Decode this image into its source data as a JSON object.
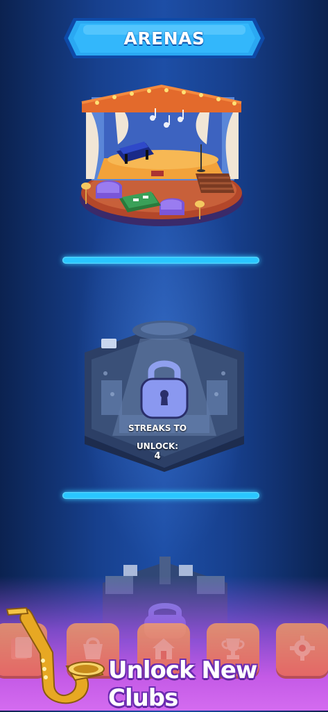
{
  "header": {
    "title": "ARENAS"
  },
  "arenas": [
    {
      "name": "music-stage-arena",
      "locked": false
    },
    {
      "name": "locked-arena-2",
      "locked": true,
      "unlock_label_1": "STREAKS TO",
      "unlock_label_2": "UNLOCK:",
      "unlock_value": "4"
    },
    {
      "name": "locked-arena-3",
      "locked": true
    }
  ],
  "promo": {
    "text": "Unlock New Clubs"
  },
  "nav": {
    "items": [
      {
        "icon": "cards-icon"
      },
      {
        "icon": "shop-icon"
      },
      {
        "icon": "home-icon"
      },
      {
        "icon": "trophy-icon"
      },
      {
        "icon": "gear-icon"
      }
    ]
  },
  "colors": {
    "progress": "#29c6ff",
    "nav_button": "#f06d3c",
    "banner": "#1ea7f0"
  }
}
